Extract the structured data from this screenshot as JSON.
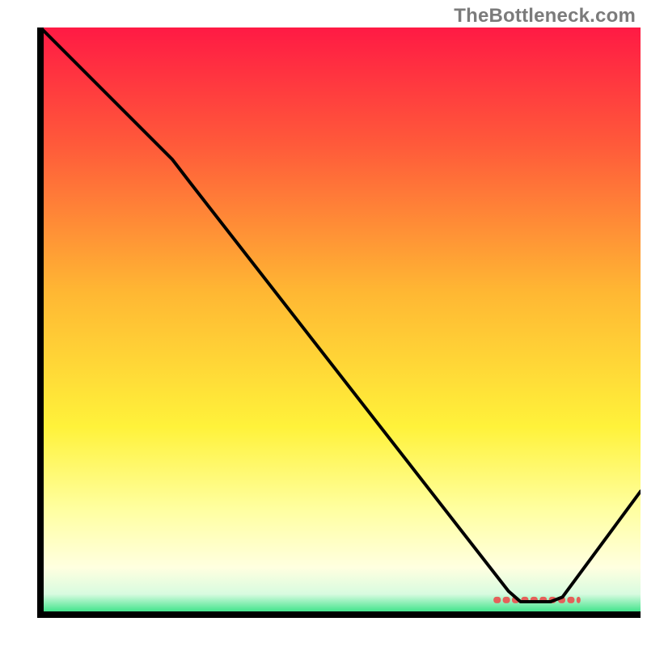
{
  "watermark": {
    "text": "TheBottleneck.com"
  },
  "chart_data": {
    "type": "line",
    "title": "",
    "xlabel": "",
    "ylabel": "",
    "xlim": [
      0,
      100
    ],
    "ylim": [
      0,
      100
    ],
    "grid": false,
    "background": {
      "type": "vertical-gradient",
      "stops": [
        {
          "offset": 0.0,
          "color": "#ff1a44"
        },
        {
          "offset": 0.2,
          "color": "#ff5a3a"
        },
        {
          "offset": 0.45,
          "color": "#ffb733"
        },
        {
          "offset": 0.68,
          "color": "#fff23a"
        },
        {
          "offset": 0.82,
          "color": "#ffffa0"
        },
        {
          "offset": 0.92,
          "color": "#ffffe0"
        },
        {
          "offset": 0.965,
          "color": "#d8fbe0"
        },
        {
          "offset": 1.0,
          "color": "#28e07e"
        }
      ]
    },
    "curve": {
      "comment": "x as % from left, y as % from top of the plot area",
      "points": [
        {
          "x": 0.0,
          "y": 0.0
        },
        {
          "x": 22.0,
          "y": 22.5
        },
        {
          "x": 25.0,
          "y": 26.5
        },
        {
          "x": 78.0,
          "y": 96.0
        },
        {
          "x": 80.0,
          "y": 97.8
        },
        {
          "x": 85.0,
          "y": 97.8
        },
        {
          "x": 87.0,
          "y": 97.0
        },
        {
          "x": 100.0,
          "y": 79.0
        }
      ]
    },
    "marker_band": {
      "comment": "red dashed/beaded band near the valley",
      "x_start": 75.5,
      "x_end": 90.0,
      "y": 97.5,
      "color": "#e4605a"
    },
    "axes": {
      "left": {
        "color": "#000000",
        "width": 8
      },
      "bottom": {
        "color": "#000000",
        "width": 8
      }
    }
  }
}
